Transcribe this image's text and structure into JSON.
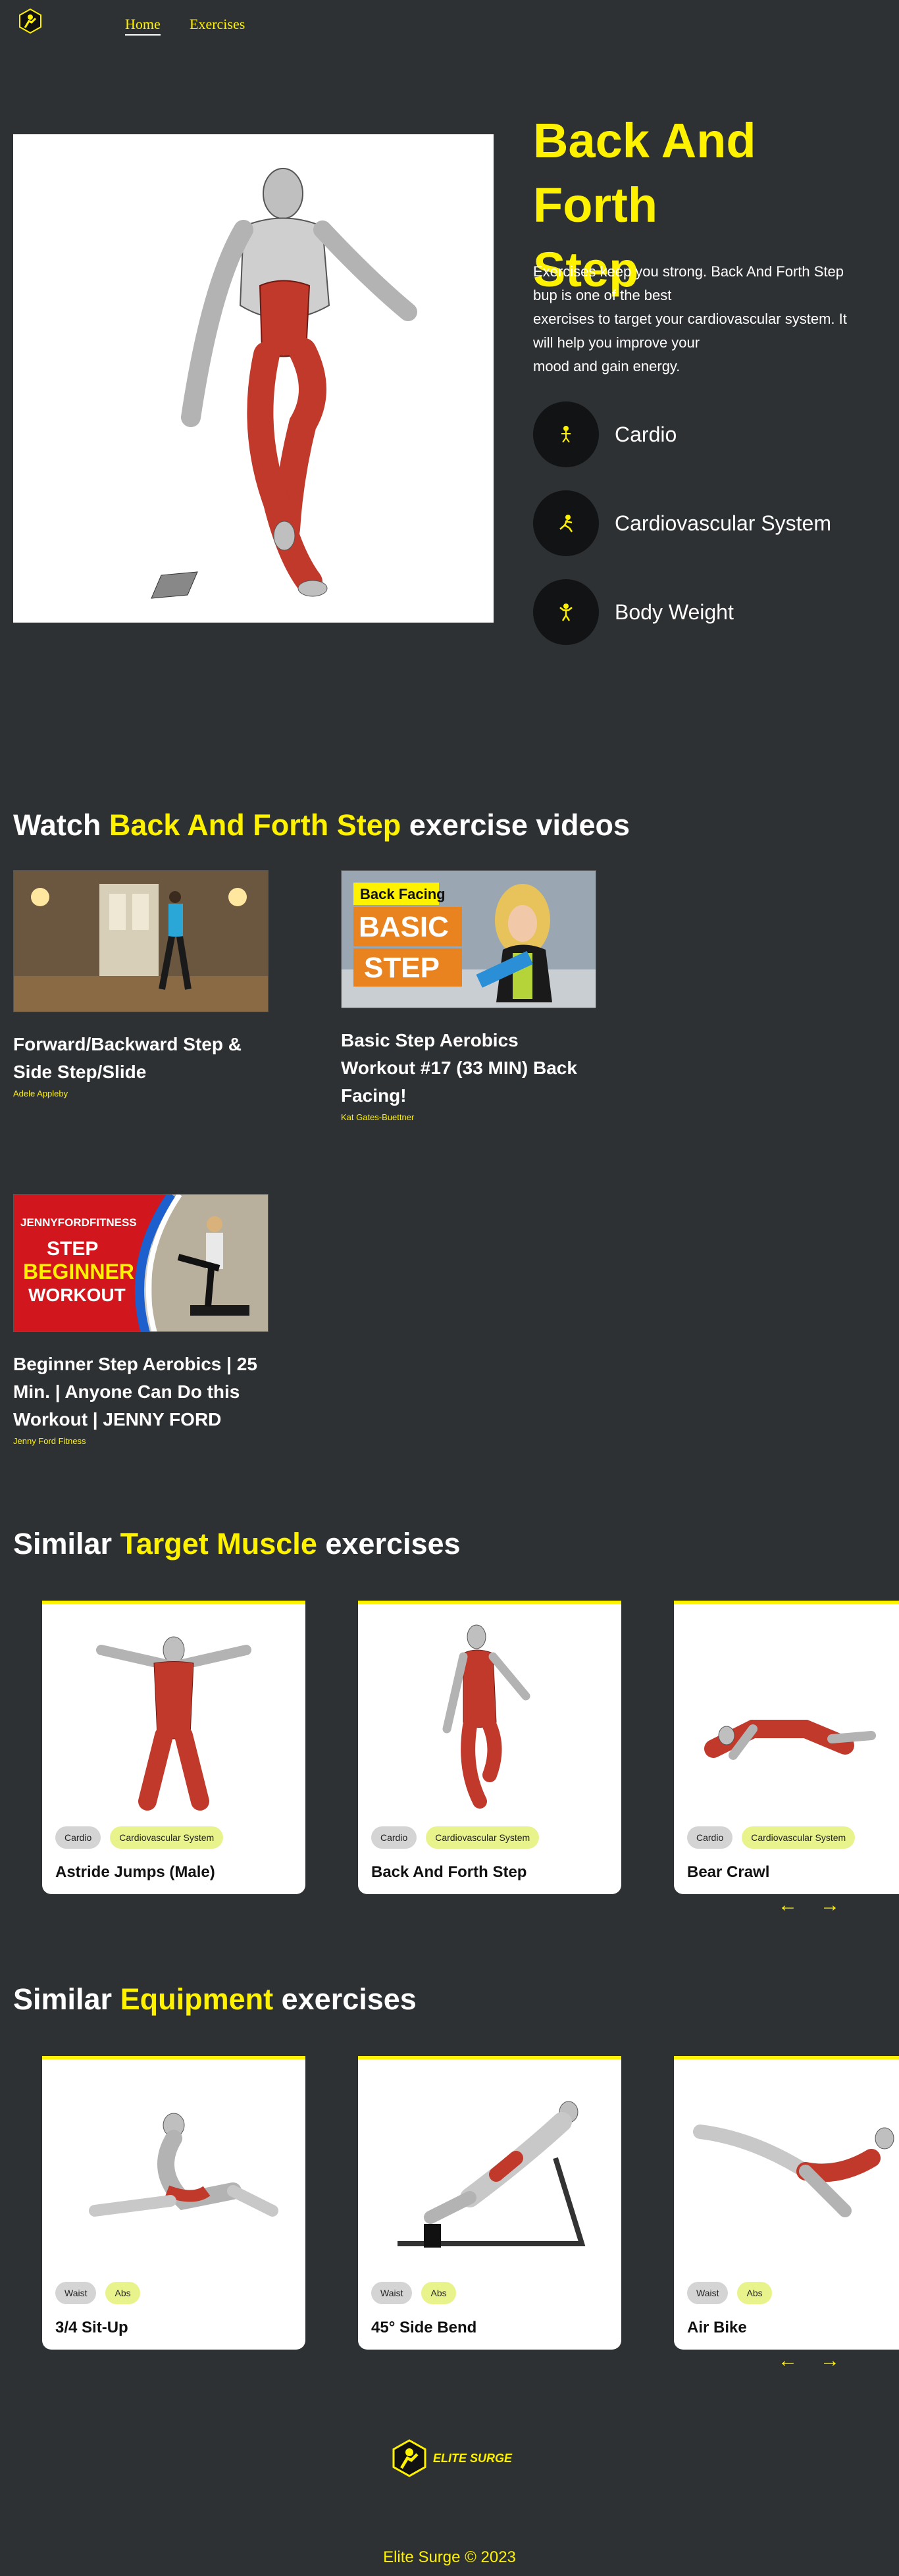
{
  "nav": {
    "logo": "elite-surge-logo",
    "links": [
      "Home",
      "Exercises"
    ]
  },
  "hero": {
    "title_line1": "Back And Forth",
    "title_line2": "Step",
    "description": [
      "Exercises keep you strong. Back And Forth Step",
      "bup is one of the best",
      "exercises to target your cardiovascular system. It",
      "will help you improve your",
      "mood and gain energy."
    ],
    "tags": [
      {
        "label": "Cardio",
        "icon": "body-part-icon"
      },
      {
        "label": "Cardiovascular System",
        "icon": "target-muscle-icon"
      },
      {
        "label": "Body Weight",
        "icon": "equipment-icon"
      }
    ]
  },
  "videos": {
    "heading_pre": "Watch",
    "heading_hl": "Back And Forth Step",
    "heading_post": "exercise videos",
    "items": [
      {
        "title": "Forward/Backward Step & Side Step/Slide",
        "author": "Adele Appleby"
      },
      {
        "title": "Basic Step Aerobics Workout #17 (33 MIN) Back Facing!",
        "author": "Kat Gates-Buettner",
        "thumb_text_1": "Back Facing",
        "thumb_text_2": "BASIC",
        "thumb_text_3": "STEP"
      },
      {
        "title": "Beginner Step Aerobics | 25 Min. | Anyone Can Do this Workout | JENNY FORD",
        "author": "Jenny Ford Fitness",
        "thumb_text_1": "JENNYFORDFITNESS",
        "thumb_text_2": "STEP",
        "thumb_text_3": "BEGINNER",
        "thumb_text_4": "WORKOUT"
      }
    ]
  },
  "similar_target": {
    "heading_pre": "Similar",
    "heading_hl": "Target Muscle",
    "heading_post": "exercises",
    "cards": [
      {
        "title": "Astride Jumps (Male)",
        "tags": [
          "Cardio",
          "Cardiovascular System"
        ]
      },
      {
        "title": "Back And Forth Step",
        "tags": [
          "Cardio",
          "Cardiovascular System"
        ]
      },
      {
        "title": "Bear Crawl",
        "tags": [
          "Cardio",
          "Cardiovascular System"
        ]
      }
    ],
    "arrows": [
      "←",
      "→"
    ]
  },
  "similar_equipment": {
    "heading_pre": "Similar",
    "heading_hl": "Equipment",
    "heading_post": "exercises",
    "cards": [
      {
        "title": "3/4 Sit-Up",
        "tags": [
          "Waist",
          "Abs"
        ]
      },
      {
        "title": "45° Side Bend",
        "tags": [
          "Waist",
          "Abs"
        ]
      },
      {
        "title": "Air Bike",
        "tags": [
          "Waist",
          "Abs"
        ]
      }
    ],
    "arrows": [
      "←",
      "→"
    ]
  },
  "footer": {
    "brand": "ELITE SURGE",
    "copyright": "Elite Surge © 2023"
  },
  "colors": {
    "background": "#2e3133",
    "accent": "#fff200",
    "muscle_red": "#c0392b",
    "pill_grey": "#d4d4d4",
    "pill_green": "#e8f38c"
  }
}
